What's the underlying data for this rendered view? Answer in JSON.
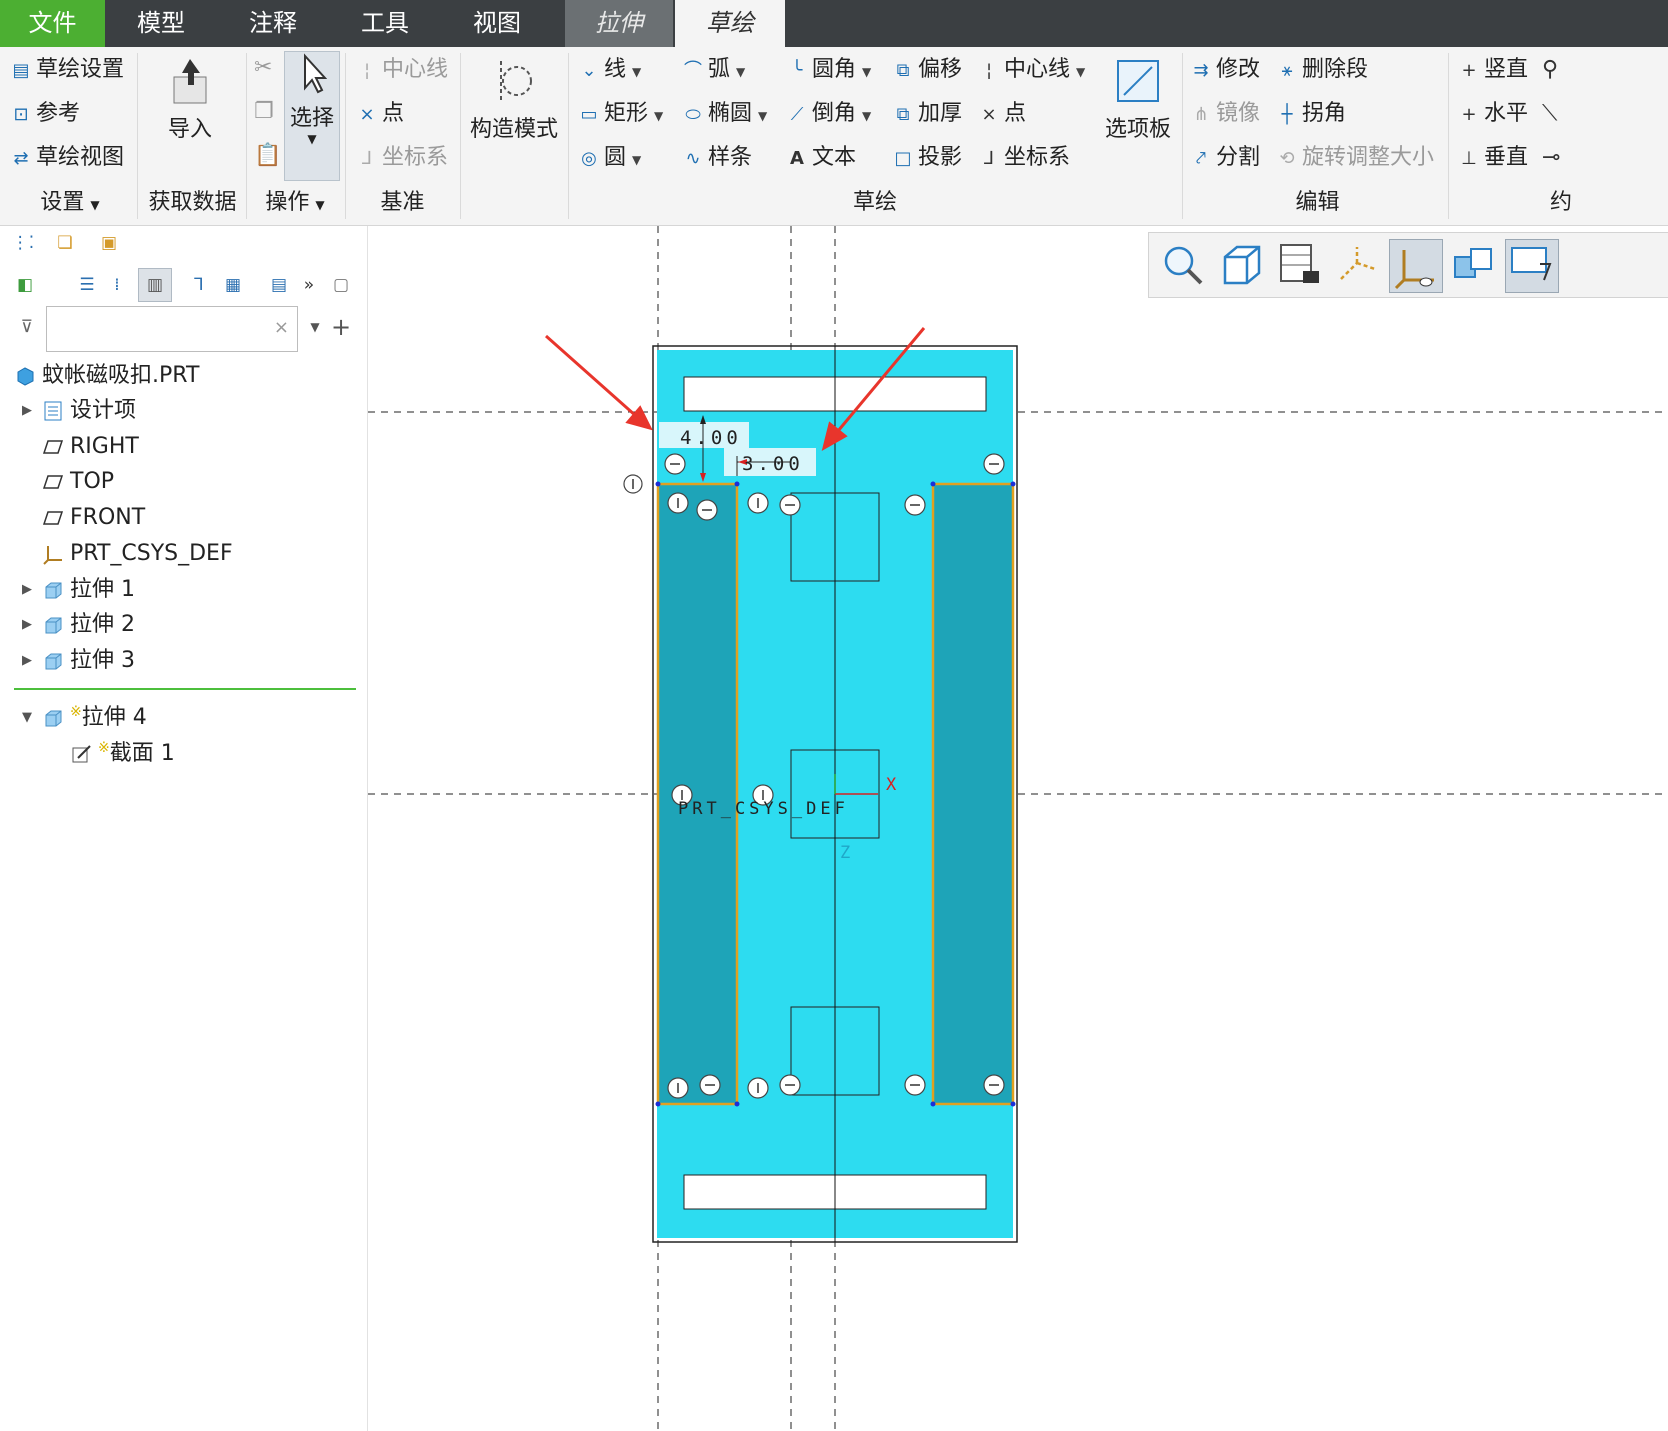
{
  "tabs": {
    "file": "文件",
    "model": "模型",
    "annotate": "注释",
    "tools": "工具",
    "view": "视图",
    "extrude": "拉伸",
    "sketch": "草绘"
  },
  "ribbon": {
    "setup": {
      "sketch_setup": "草绘设置",
      "references": "参考",
      "sketch_view": "草绘视图",
      "group": "设置"
    },
    "get_data": {
      "import": "导入",
      "group": "获取数据"
    },
    "operations": {
      "select": "选择",
      "group": "操作"
    },
    "datum": {
      "centerline": "中心线",
      "point": "点",
      "csys": "坐标系",
      "group": "基准"
    },
    "construction": {
      "label": "构造模式"
    },
    "sketching": {
      "line": "线",
      "arc": "弧",
      "fillet": "圆角",
      "offset": "偏移",
      "centerline": "中心线",
      "rectangle": "矩形",
      "ellipse": "椭圆",
      "chamfer": "倒角",
      "thicken": "加厚",
      "point": "点",
      "circle": "圆",
      "spline": "样条",
      "text": "文本",
      "project": "投影",
      "csys": "坐标系",
      "palette": "选项板",
      "group": "草绘"
    },
    "editing": {
      "modify": "修改",
      "delete_segment": "删除段",
      "mirror": "镜像",
      "corner": "拐角",
      "divide": "分割",
      "rotate_resize": "旋转调整大小",
      "group": "编辑"
    },
    "constrain": {
      "vertical": "竖直",
      "horizontal": "水平",
      "perpendicular": "垂直",
      "group": "约"
    }
  },
  "model_tree": {
    "filter_placeholder": "",
    "items": [
      {
        "label": "蚊帐磁吸扣.PRT",
        "icon": "part-icon",
        "expand": ""
      },
      {
        "label": "设计项",
        "icon": "design-items-icon",
        "expand": "▶"
      },
      {
        "label": "RIGHT",
        "icon": "datum-plane-icon",
        "expand": ""
      },
      {
        "label": "TOP",
        "icon": "datum-plane-icon",
        "expand": ""
      },
      {
        "label": "FRONT",
        "icon": "datum-plane-icon",
        "expand": ""
      },
      {
        "label": "PRT_CSYS_DEF",
        "icon": "csys-icon",
        "expand": ""
      },
      {
        "label": "拉伸 1",
        "icon": "extrude-icon",
        "expand": "▶"
      },
      {
        "label": "拉伸 2",
        "icon": "extrude-icon",
        "expand": "▶"
      },
      {
        "label": "拉伸 3",
        "icon": "extrude-icon",
        "expand": "▶"
      },
      {
        "label": "拉伸 4",
        "icon": "extrude-icon",
        "expand": "▼",
        "new": "※"
      },
      {
        "label": "截面 1",
        "icon": "sketch-icon",
        "expand": "",
        "new": "※"
      }
    ]
  },
  "sketch": {
    "dim_vertical": "4.00",
    "dim_horizontal": "3.00",
    "csys_label": "PRT_CSYS_DEF",
    "axis_x": "X",
    "axis_z": "Z"
  },
  "colors": {
    "accent_green": "#4caf32",
    "sketch_fill": "#2ddcf0",
    "region_fill": "#1ea4b8",
    "highlight_edge": "#e0a020",
    "arrow_red": "#e8352c"
  }
}
